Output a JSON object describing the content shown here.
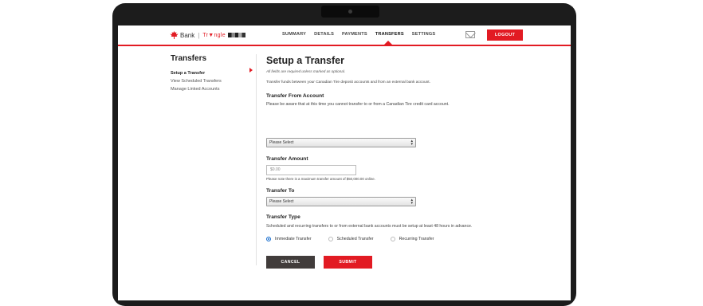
{
  "header": {
    "brand": "Bank",
    "partner": "Tr▼ngle",
    "nav": [
      "SUMMARY",
      "DETAILS",
      "PAYMENTS",
      "TRANSFERS",
      "SETTINGS"
    ],
    "active_nav": "TRANSFERS",
    "logout": "LOGOUT"
  },
  "sidebar": {
    "title": "Transfers",
    "items": [
      "Setup a Transfer",
      "View Scheduled Transfers",
      "Manage Linked Accounts"
    ]
  },
  "main": {
    "title": "Setup a Transfer",
    "required_note": "All fields are required unless marked as optional.",
    "intro": "Transfer funds between your Canadian Tire deposit accounts and from an external bank account.",
    "from": {
      "label": "Transfer From Account",
      "desc": "Please be aware that at this time you cannot transfer to or from a Canadian Tire credit card account.",
      "select": "Please Select"
    },
    "amount": {
      "label": "Transfer Amount",
      "placeholder": "$0.00",
      "note": "Please note there is a maximum transfer amount of $50,000.00 online."
    },
    "to": {
      "label": "Transfer To",
      "select": "Please Select"
    },
    "type": {
      "label": "Transfer Type",
      "desc": "Scheduled and recurring transfers to or from external bank accounts must be setup at least 48 hours in advance.",
      "options": [
        "Immediate Transfer",
        "Scheduled Transfer",
        "Recurring Transfer"
      ],
      "selected": "Immediate Transfer"
    },
    "cancel": "CANCEL",
    "submit": "SUBMIT"
  },
  "colors": {
    "accent": "#e21b23",
    "dark_button": "#413c3b",
    "radio": "#1a6fcf"
  }
}
